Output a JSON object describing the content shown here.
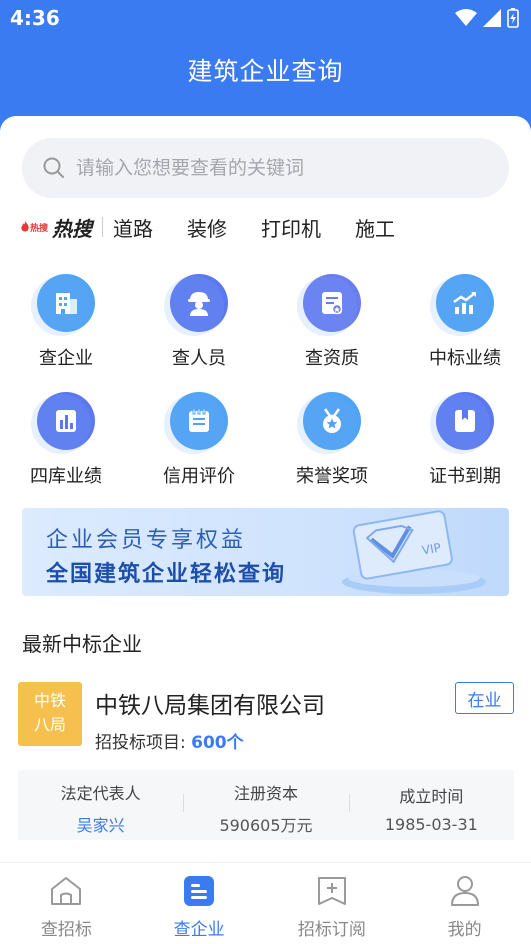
{
  "status": {
    "time": "4:36"
  },
  "header": {
    "title": "建筑企业查询"
  },
  "search": {
    "placeholder": "请输入您想要查看的关键词"
  },
  "hot": {
    "logo_small": "热搜",
    "logo_big": "热搜",
    "words": [
      "道路",
      "装修",
      "打印机",
      "施工"
    ]
  },
  "grid": [
    {
      "label": "查企业",
      "icon": "building-icon"
    },
    {
      "label": "查人员",
      "icon": "worker-icon"
    },
    {
      "label": "查资质",
      "icon": "certificate-icon"
    },
    {
      "label": "中标业绩",
      "icon": "trend-chart-icon"
    },
    {
      "label": "四库业绩",
      "icon": "bar-chart-icon"
    },
    {
      "label": "信用评价",
      "icon": "notepad-icon"
    },
    {
      "label": "荣誉奖项",
      "icon": "medal-icon"
    },
    {
      "label": "证书到期",
      "icon": "book-icon"
    }
  ],
  "banner": {
    "line1": "企业会员专享权益",
    "line2": "全国建筑企业轻松查询",
    "vip": "VIP"
  },
  "section": {
    "title": "最新中标企业"
  },
  "company": {
    "logo_line1": "中铁",
    "logo_line2": "八局",
    "name": "中铁八局集团有限公司",
    "status": "在业",
    "projects_label": "招投标项目: ",
    "projects_count": "600个"
  },
  "info": [
    {
      "label": "法定代表人",
      "value": "吴家兴"
    },
    {
      "label": "注册资本",
      "value": "590605万元"
    },
    {
      "label": "成立时间",
      "value": "1985-03-31"
    }
  ],
  "tabs": [
    {
      "label": "查招标",
      "icon": "home-icon"
    },
    {
      "label": "查企业",
      "icon": "enterprise-icon"
    },
    {
      "label": "招标订阅",
      "icon": "subscribe-icon"
    },
    {
      "label": "我的",
      "icon": "user-icon"
    }
  ],
  "colors": {
    "primary": "#3A7BF2",
    "logo_bg": "#F6C04E"
  }
}
